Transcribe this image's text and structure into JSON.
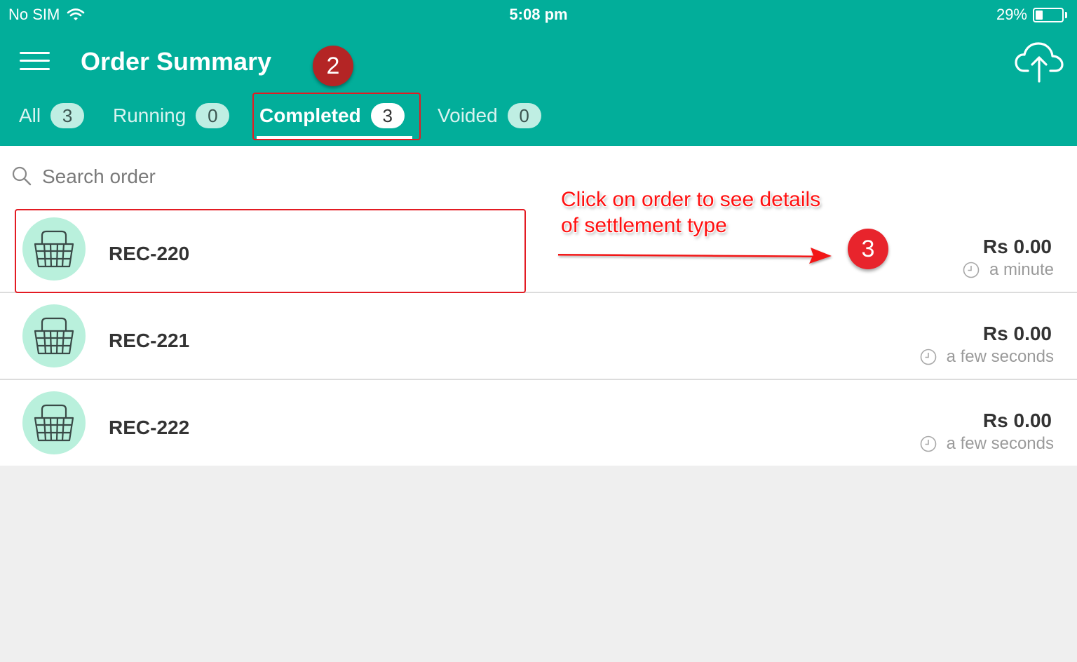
{
  "status_bar": {
    "carrier": "No SIM",
    "time": "5:08 pm",
    "battery_text": "29%",
    "battery_level": 0.29
  },
  "header": {
    "title": "Order Summary",
    "menu_icon": "hamburger-menu-icon",
    "upload_icon": "cloud-upload-icon",
    "background_color": "#02ae9a"
  },
  "tabs": [
    {
      "label": "All",
      "count": "3"
    },
    {
      "label": "Running",
      "count": "0"
    },
    {
      "label": "Completed",
      "count": "3",
      "active": true
    },
    {
      "label": "Voided",
      "count": "0"
    }
  ],
  "search": {
    "placeholder": "Search order",
    "value": ""
  },
  "orders": [
    {
      "id": "REC-220",
      "amount": "Rs 0.00",
      "time": "a minute"
    },
    {
      "id": "REC-221",
      "amount": "Rs 0.00",
      "time": "a few seconds"
    },
    {
      "id": "REC-222",
      "amount": "Rs 0.00",
      "time": "a few seconds"
    }
  ],
  "annotations": {
    "badge_2": "2",
    "badge_3": "3",
    "instruction_line1": "Click on order to see details",
    "instruction_line2": "of settlement type",
    "color": "#e31b23"
  }
}
